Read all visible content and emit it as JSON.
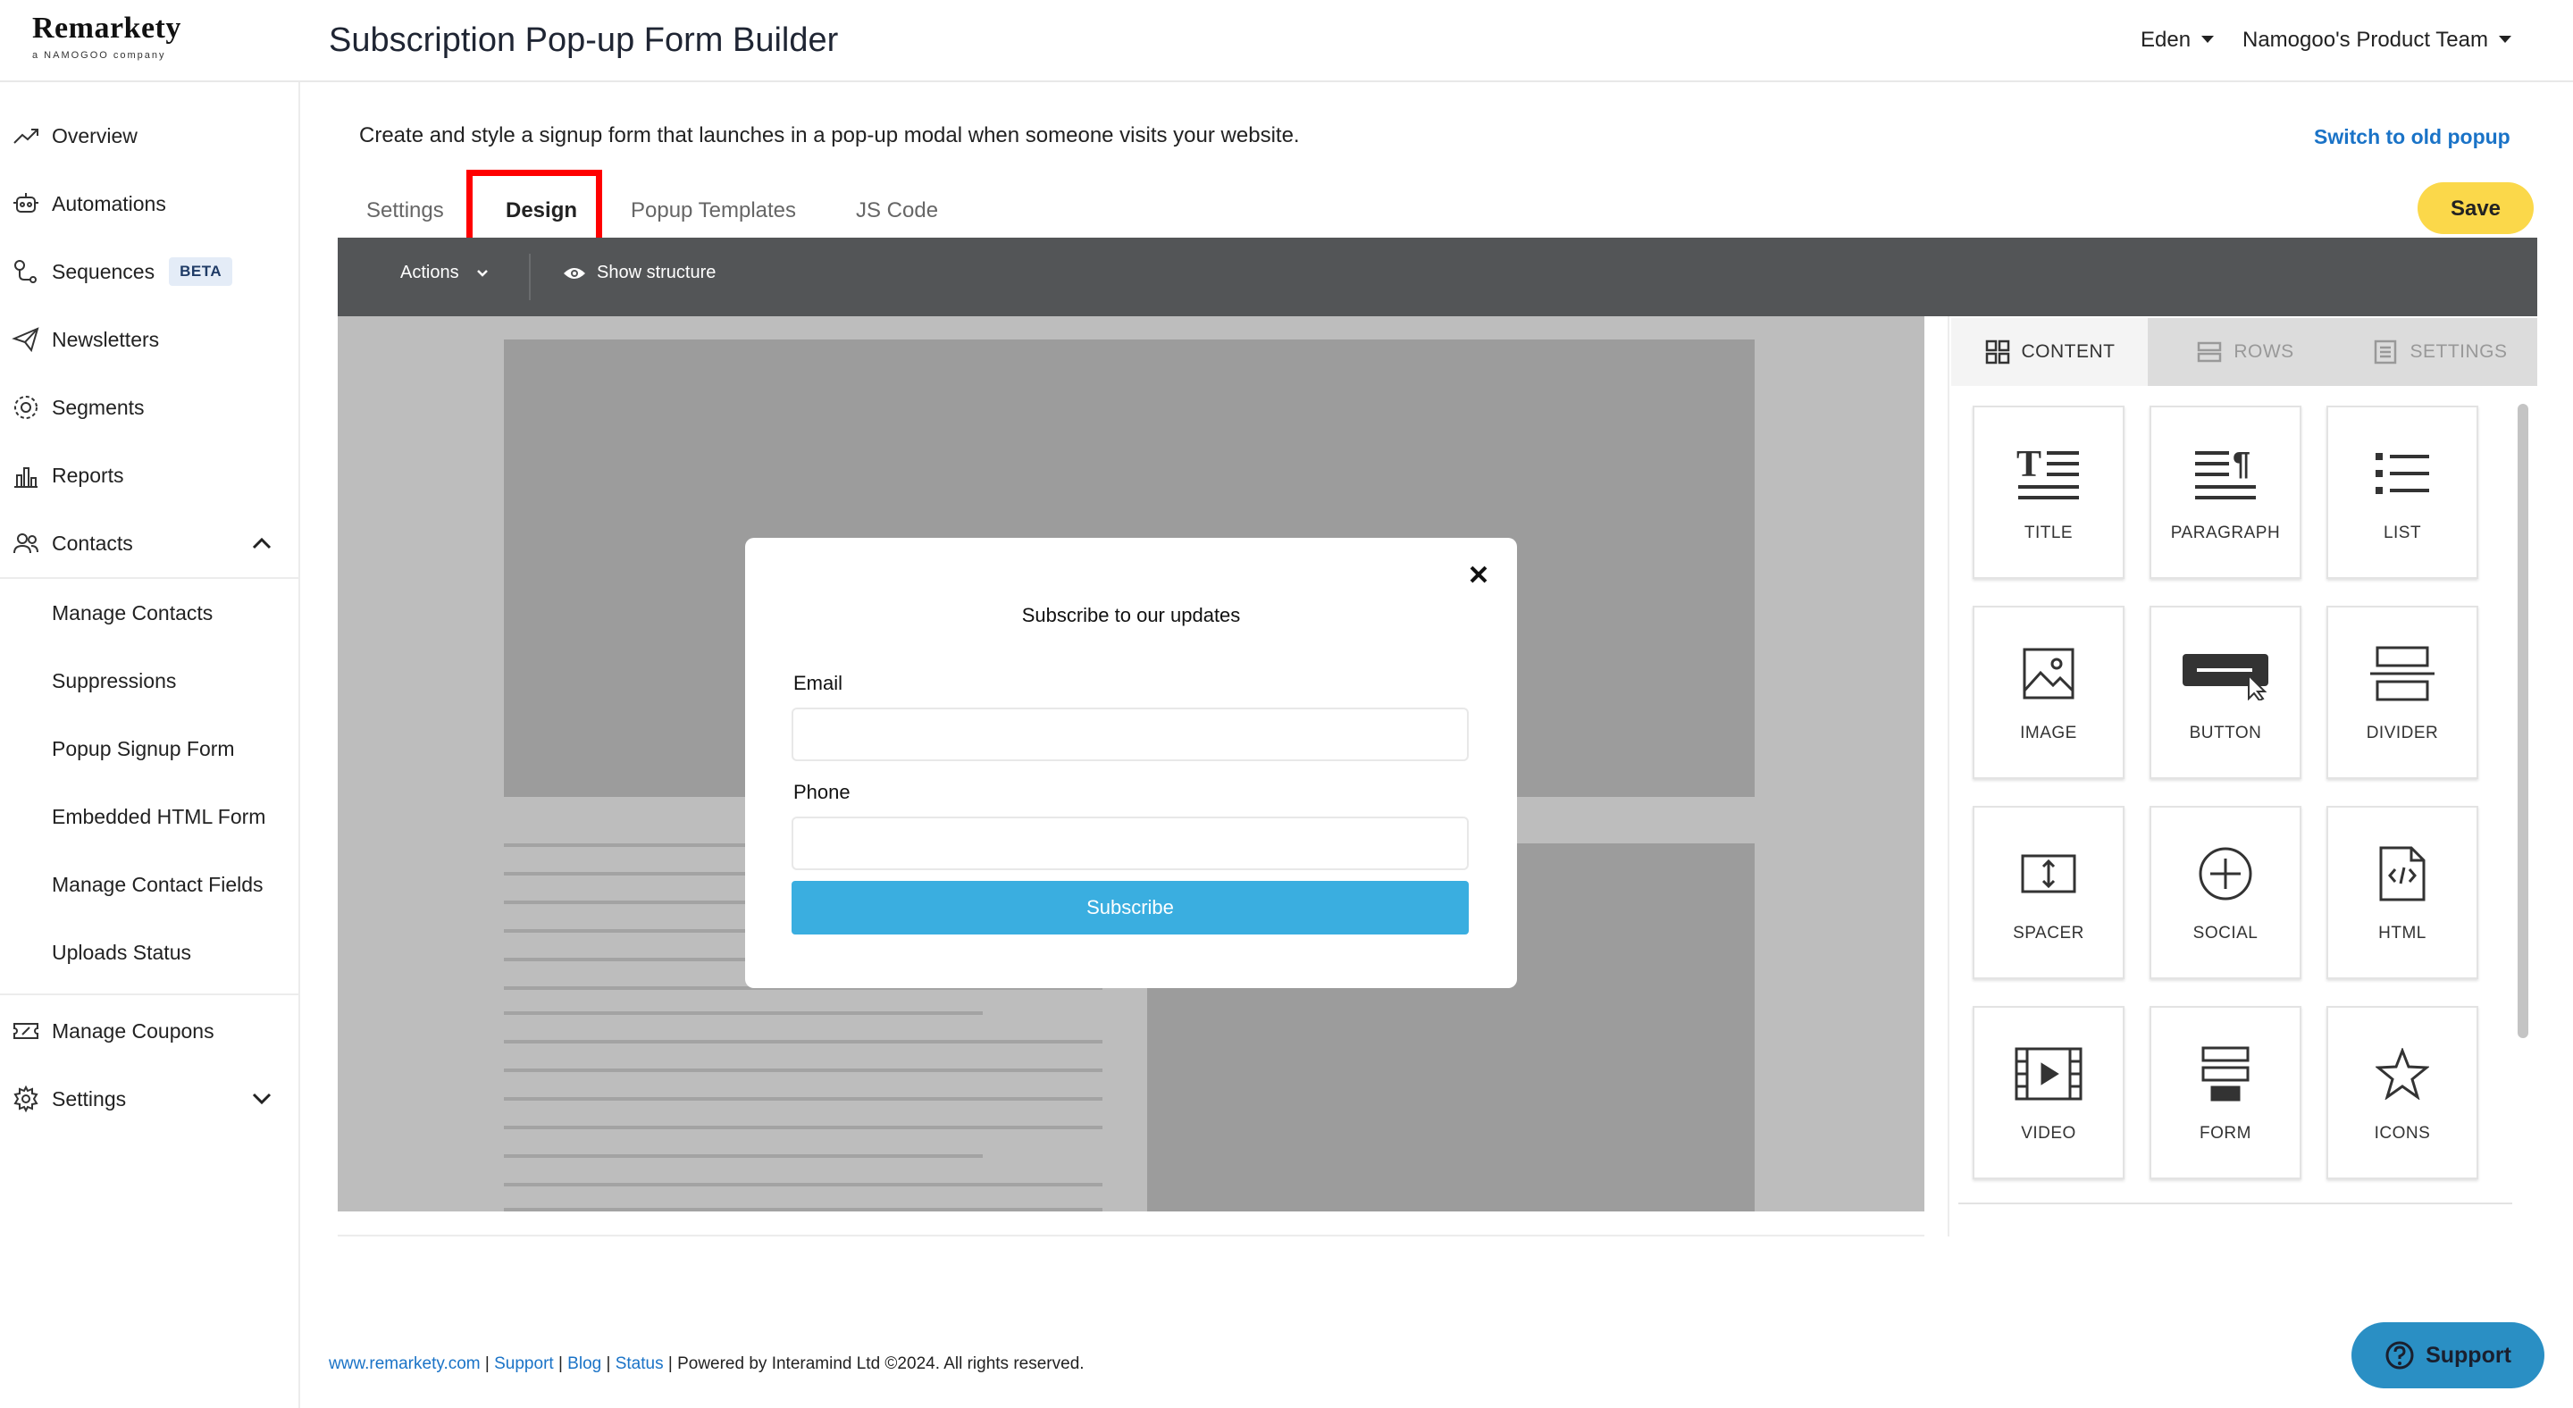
{
  "header": {
    "brand": "Remarkety",
    "brand_sub": "a NAMOGOO company",
    "title": "Subscription Pop-up Form Builder",
    "user": "Eden",
    "team": "Namogoo's Product Team"
  },
  "sidebar": {
    "items": [
      {
        "label": "Overview",
        "icon": "trend-up-icon"
      },
      {
        "label": "Automations",
        "icon": "robot-icon"
      },
      {
        "label": "Sequences",
        "icon": "route-icon",
        "badge": "BETA"
      },
      {
        "label": "Newsletters",
        "icon": "paper-plane-icon"
      },
      {
        "label": "Segments",
        "icon": "segments-icon"
      },
      {
        "label": "Reports",
        "icon": "bar-chart-icon"
      },
      {
        "label": "Contacts",
        "icon": "users-icon"
      }
    ],
    "contacts_sub": [
      "Manage Contacts",
      "Suppressions",
      "Popup Signup Form",
      "Embedded HTML Form",
      "Manage Contact Fields",
      "Uploads Status"
    ],
    "bottom_items": [
      {
        "label": "Manage Coupons",
        "icon": "coupon-icon"
      },
      {
        "label": "Settings",
        "icon": "gear-icon"
      }
    ]
  },
  "main": {
    "description": "Create and style a signup form that launches in a pop-up modal when someone visits your website.",
    "switch_link": "Switch to old popup",
    "tabs": [
      "Settings",
      "Design",
      "Popup Templates",
      "JS Code"
    ],
    "active_tab": "Design",
    "save_label": "Save"
  },
  "toolbar": {
    "actions": "Actions",
    "show_structure": "Show structure"
  },
  "modal": {
    "title": "Subscribe to our updates",
    "email_label": "Email",
    "phone_label": "Phone",
    "subscribe_label": "Subscribe"
  },
  "panel": {
    "tabs": [
      "CONTENT",
      "ROWS",
      "SETTINGS"
    ],
    "active_tab": "CONTENT",
    "blocks": [
      "TITLE",
      "PARAGRAPH",
      "LIST",
      "IMAGE",
      "BUTTON",
      "DIVIDER",
      "SPACER",
      "SOCIAL",
      "HTML",
      "VIDEO",
      "FORM",
      "ICONS"
    ]
  },
  "footer": {
    "site": "www.remarkety.com",
    "support": "Support",
    "blog": "Blog",
    "status": "Status",
    "powered": "Powered by Interamind Ltd ©2024. All rights reserved.",
    "sep": "|"
  },
  "support_button": "Support",
  "colors": {
    "accent": "#fbd84a",
    "link": "#1a73c7",
    "subscribe": "#3aaee0",
    "toolbar": "#535557",
    "highlight": "#ff0000"
  }
}
